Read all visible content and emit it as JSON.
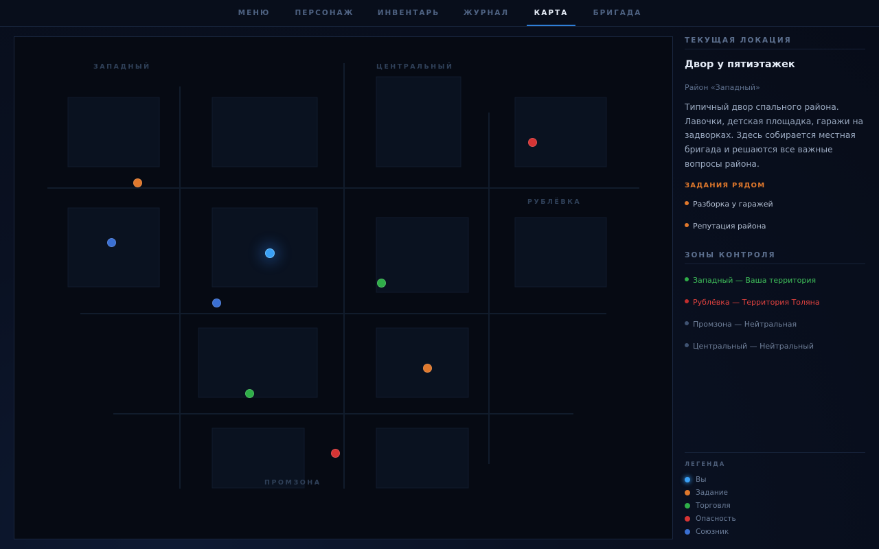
{
  "nav": {
    "tabs": [
      {
        "label": "МЕНЮ"
      },
      {
        "label": "ПЕРСОНАЖ"
      },
      {
        "label": "ИНВЕНТАРЬ"
      },
      {
        "label": "ЖУРНАЛ"
      },
      {
        "label": "КАРТА"
      },
      {
        "label": "БРИГАДА"
      }
    ],
    "active": "КАРТА"
  },
  "map": {
    "districts": {
      "west": "ЗАПАДНЫЙ",
      "central": "ЦЕНТРАЛЬНЫЙ",
      "rublevka": "РУБЛЁВКА",
      "promzona": "ПРОМЗОНА"
    }
  },
  "location": {
    "section_title": "ТЕКУЩАЯ ЛОКАЦИЯ",
    "name": "Двор у пятиэтажек",
    "district": "Район «Западный»",
    "description": "Типичный двор спального района. Лавочки, детская площадка, гаражи на задворках. Здесь собирается местная бригада и решаются все важные вопросы района."
  },
  "quests": {
    "title": "ЗАДАНИЯ РЯДОМ",
    "items": [
      {
        "label": "Разборка у гаражей"
      },
      {
        "label": "Репутация района"
      }
    ]
  },
  "zones": {
    "title": "ЗОНЫ КОНТРОЛЯ",
    "items": [
      {
        "label": "Западный — Ваша территория",
        "color": "#3fbf5a"
      },
      {
        "label": "Рублёвка — Территория Толяна",
        "color": "#e0423f"
      },
      {
        "label": "Промзона — Нейтральная",
        "color": "#6f7f99"
      },
      {
        "label": "Центральный — Нейтральный",
        "color": "#6f7f99"
      }
    ]
  },
  "legend": {
    "title": "ЛЕГЕНДА",
    "items": [
      {
        "label": "Вы",
        "color": "#3aa0f5"
      },
      {
        "label": "Задание",
        "color": "#e0782c"
      },
      {
        "label": "Торговля",
        "color": "#2fae48"
      },
      {
        "label": "Опасность",
        "color": "#d63434"
      },
      {
        "label": "Союзник",
        "color": "#3a6fd2"
      }
    ]
  },
  "colors": {
    "accent": "#2f7fd8",
    "quest": "#e0782c",
    "trade": "#2fae48",
    "danger": "#d63434",
    "ally": "#3a6fd2",
    "player": "#3aa0f5"
  }
}
